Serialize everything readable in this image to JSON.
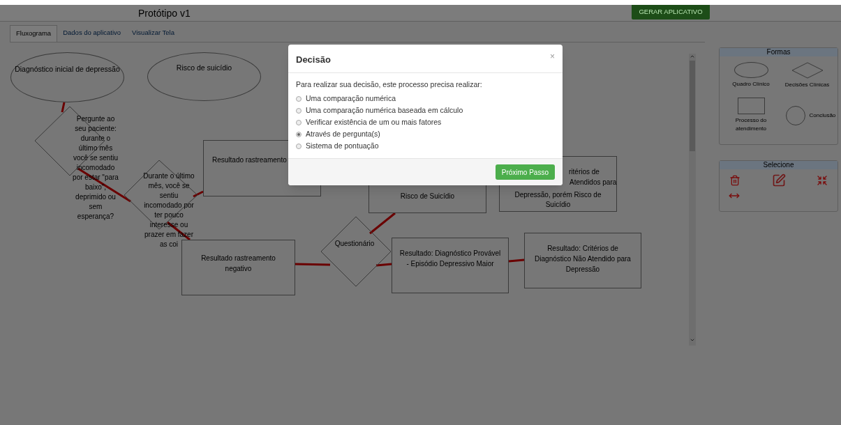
{
  "header": {
    "title": "Protótipo v1",
    "generate_button": "GERAR APLICATIVO"
  },
  "tabs": [
    {
      "label": "Fluxograma",
      "selected": true
    },
    {
      "label": "Dados do aplicativo",
      "selected": false
    },
    {
      "label": "Visualizar Tela",
      "selected": false
    }
  ],
  "flowchart": {
    "nodes": [
      {
        "kind": "ellipse",
        "text": "Diagnóstico inicial de depressão"
      },
      {
        "kind": "ellipse",
        "text": "Risco de suicídio"
      },
      {
        "kind": "diamond",
        "text": "Pergunte ao seu paciente: durante o último mês você se sentiu incomodado por estar \"para baixo\", deprimido ou sem esperança?"
      },
      {
        "kind": "diamond",
        "text": "Durante o último mês, você se sentiu incomodado por ter pouco interesse ou prazer em fazer as coi"
      },
      {
        "kind": "rect",
        "text": "Resultado rastreamento"
      },
      {
        "kind": "rect",
        "text": "Risco de Suicídio"
      },
      {
        "kind": "rect",
        "lines": [
          "ritérios de",
          "Atendidos para",
          "Depressão, porém Risco de",
          "Suicídio"
        ]
      },
      {
        "kind": "rect",
        "text": "Resultado rastreamento negativo"
      },
      {
        "kind": "diamond",
        "text": "Questionário"
      },
      {
        "kind": "rect",
        "text": "Resultado: Diagnóstico Provável - Episódio Depressivo Maior"
      },
      {
        "kind": "rect",
        "text": "Resultado: Critérios de Diagnóstico Não Atendido para Depressão"
      }
    ]
  },
  "palette": {
    "title": "Formas",
    "shapes": [
      {
        "kind": "ellipse",
        "label": "Quadro Clínico"
      },
      {
        "kind": "diamond",
        "label": "Decisões Clínicas"
      },
      {
        "kind": "rect",
        "label": "Processo do atendimento"
      },
      {
        "kind": "circle",
        "label": "Conclusão"
      }
    ]
  },
  "select_panel": {
    "title": "Selecione"
  },
  "dialog": {
    "title": "Decisão",
    "close": "×",
    "prompt": "Para realizar sua decisão, este processo precisa realizar:",
    "options": [
      {
        "label": "Uma comparação numérica",
        "selected": false
      },
      {
        "label": "Uma comparação numérica baseada em cálculo",
        "selected": false
      },
      {
        "label": "Verificar existência de um ou mais fatores",
        "selected": false
      },
      {
        "label": "Através de pergunta(s)",
        "selected": true
      },
      {
        "label": "Sistema de pontuação",
        "selected": false
      }
    ],
    "next_button": "Próximo Passo"
  }
}
